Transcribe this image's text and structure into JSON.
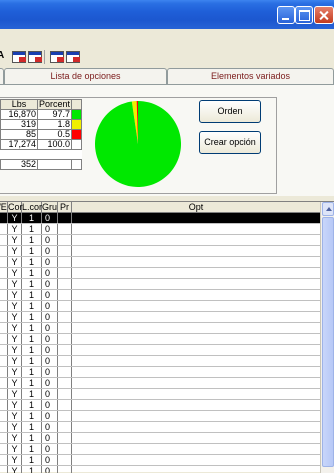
{
  "toolbar": {
    "partial_icon_glyph": "A",
    "icons": [
      "table-export-icon",
      "table-export-icon",
      "table-export-icon",
      "table-export-icon"
    ]
  },
  "tabs": [
    {
      "label": "",
      "active": false
    },
    {
      "label": "Lista de opciones",
      "active": false
    },
    {
      "label": "Elementos variados",
      "active": false
    }
  ],
  "summary": {
    "headers": [
      "Lbs",
      "Porcent"
    ],
    "rows": [
      {
        "lbs": "16,870",
        "pct": "97.7",
        "color": "#00e800"
      },
      {
        "lbs": "319",
        "pct": "1.8",
        "color": "#f0f000"
      },
      {
        "lbs": "85",
        "pct": "0.5",
        "color": "#ff0000"
      },
      {
        "lbs": "17,274",
        "pct": "100.0",
        "color": "#ffffff"
      },
      {
        "lbs": "",
        "pct": "",
        "color": "#ffffff"
      },
      {
        "lbs": "352",
        "pct": "",
        "color": "#ffffff"
      }
    ]
  },
  "pie": {
    "slices": [
      97.7,
      1.8,
      0.5
    ],
    "colors": [
      "#00e800",
      "#f0f000",
      "#ff0000"
    ]
  },
  "buttons": {
    "orden": "Orden",
    "crear_opcion": "Crear opción"
  },
  "grid": {
    "headers": [
      "/E",
      "Cor",
      "L.cor",
      "Gru",
      "Pr",
      "Opt"
    ],
    "rows": [
      [
        "",
        "Y",
        "1",
        "0",
        "",
        ""
      ],
      [
        "",
        "Y",
        "1",
        "0",
        "",
        ""
      ],
      [
        "",
        "Y",
        "1",
        "0",
        "",
        ""
      ],
      [
        "",
        "Y",
        "1",
        "0",
        "",
        ""
      ],
      [
        "",
        "Y",
        "1",
        "0",
        "",
        ""
      ],
      [
        "",
        "Y",
        "1",
        "0",
        "",
        ""
      ],
      [
        "",
        "Y",
        "1",
        "0",
        "",
        ""
      ],
      [
        "",
        "Y",
        "1",
        "0",
        "",
        ""
      ],
      [
        "",
        "Y",
        "1",
        "0",
        "",
        ""
      ],
      [
        "",
        "Y",
        "1",
        "0",
        "",
        ""
      ],
      [
        "",
        "Y",
        "1",
        "0",
        "",
        ""
      ],
      [
        "",
        "Y",
        "1",
        "0",
        "",
        ""
      ],
      [
        "",
        "Y",
        "1",
        "0",
        "",
        ""
      ],
      [
        "",
        "Y",
        "1",
        "0",
        "",
        ""
      ],
      [
        "",
        "Y",
        "1",
        "0",
        "",
        ""
      ],
      [
        "",
        "Y",
        "1",
        "0",
        "",
        ""
      ],
      [
        "",
        "Y",
        "1",
        "0",
        "",
        ""
      ],
      [
        "",
        "Y",
        "1",
        "0",
        "",
        ""
      ],
      [
        "",
        "Y",
        "1",
        "0",
        "",
        ""
      ],
      [
        "",
        "Y",
        "1",
        "0",
        "",
        ""
      ],
      [
        "",
        "Y",
        "1",
        "0",
        "",
        ""
      ],
      [
        "",
        "Y",
        "1",
        "0",
        "",
        ""
      ],
      [
        "",
        "Y",
        "1",
        "0",
        "",
        ""
      ],
      [
        "",
        "Y",
        "1",
        "0",
        "",
        ""
      ]
    ]
  }
}
